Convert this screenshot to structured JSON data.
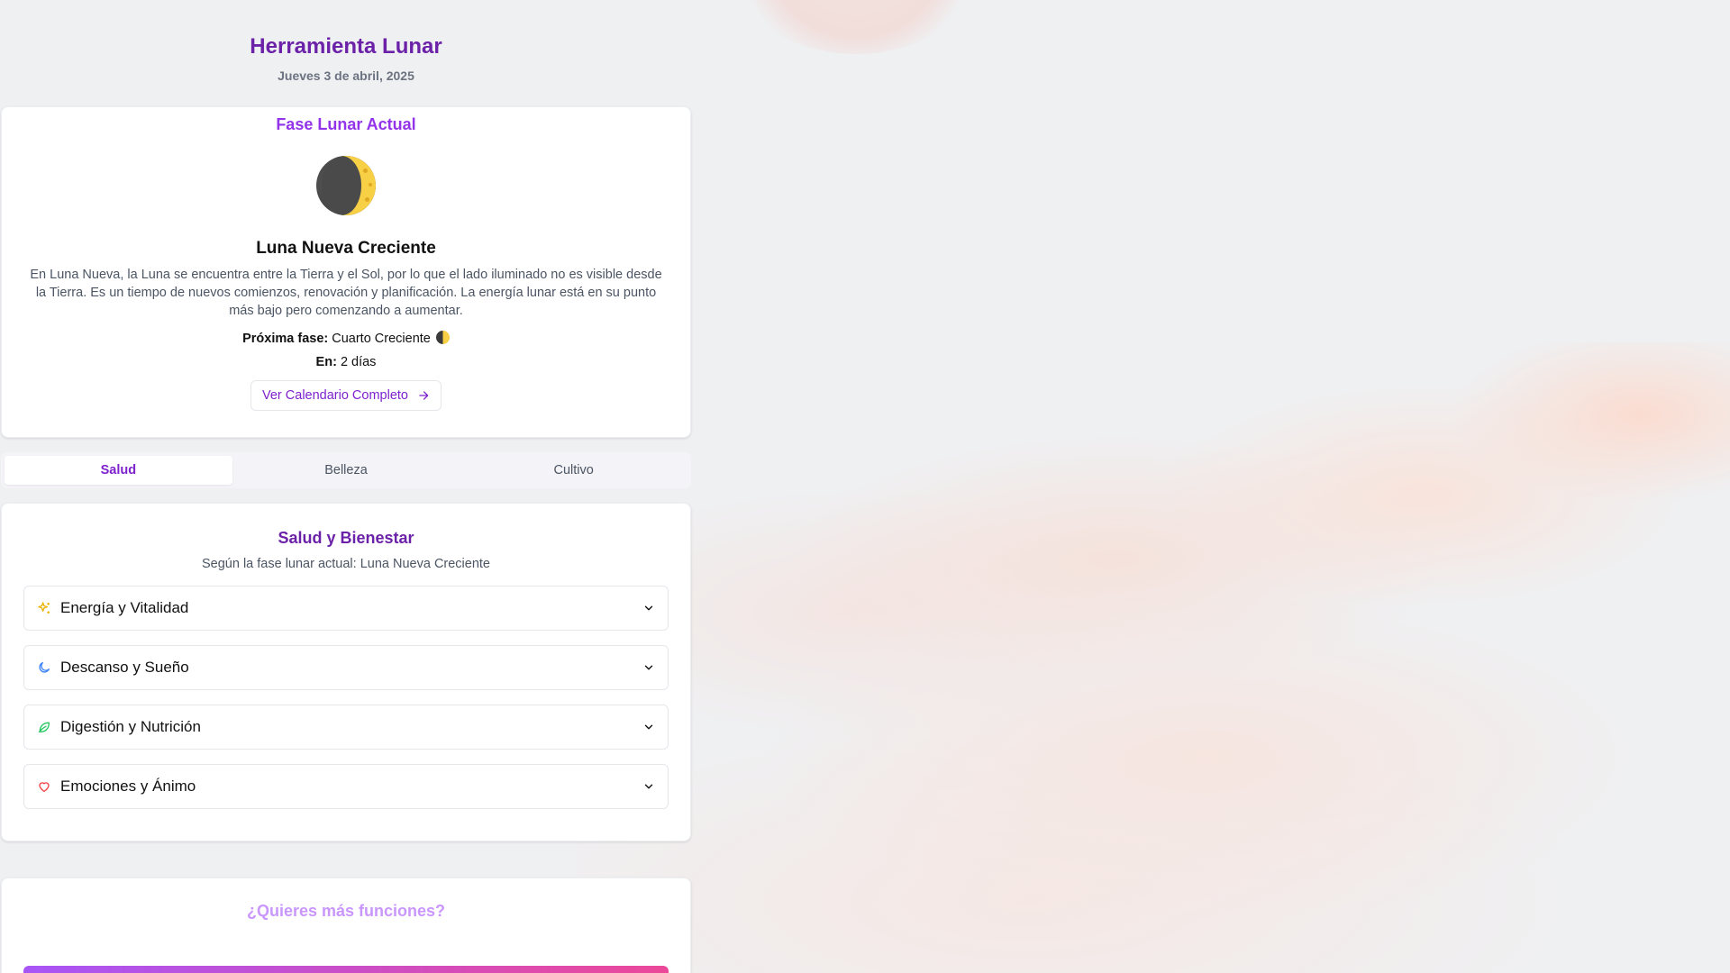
{
  "header": {
    "title": "Herramienta Lunar",
    "date": "Jueves 3 de abril, 2025"
  },
  "phase_card": {
    "heading": "Fase Lunar Actual",
    "moon_icon": "waxing-crescent-moon-icon",
    "phase_name": "Luna Nueva Creciente",
    "description": "En Luna Nueva, la Luna se encuentra entre la Tierra y el Sol, por lo que el lado iluminado no es visible desde la Tierra. Es un tiempo de nuevos comienzos, renovación y planificación. La energía lunar está en su punto más bajo pero comenzando a aumentar.",
    "next_label": "Próxima fase:",
    "next_value": "Cuarto Creciente",
    "next_icon": "first-quarter-moon-icon",
    "in_label": "En:",
    "in_value": "2 días",
    "calendar_button": "Ver Calendario Completo"
  },
  "tabs": [
    {
      "label": "Salud",
      "active": true
    },
    {
      "label": "Belleza",
      "active": false
    },
    {
      "label": "Cultivo",
      "active": false
    }
  ],
  "health": {
    "title": "Salud y Bienestar",
    "subtitle": "Según la fase lunar actual: Luna Nueva Creciente",
    "items": [
      {
        "label": "Energía y Vitalidad",
        "icon": "sparkles-icon",
        "color": "#eab308"
      },
      {
        "label": "Descanso y Sueño",
        "icon": "moon-icon",
        "color": "#3b82f6"
      },
      {
        "label": "Digestión y Nutrición",
        "icon": "leaf-icon",
        "color": "#22c55e"
      },
      {
        "label": "Emociones y Ánimo",
        "icon": "heart-icon",
        "color": "#ef4444"
      }
    ]
  },
  "more": {
    "title": "¿Quieres más funciones?"
  },
  "colors": {
    "accent": "#7e22ce",
    "accent_light": "#9333ea",
    "background": "#eff0f2"
  }
}
